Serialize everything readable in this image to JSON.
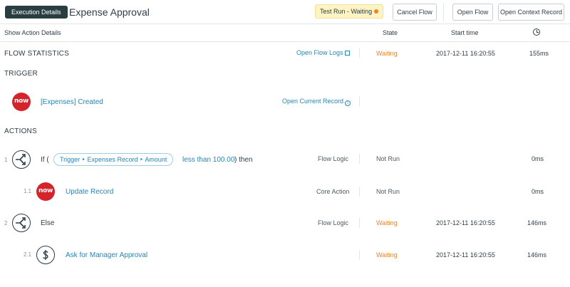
{
  "header": {
    "exec_label": "Execution Details",
    "title": "Expense Approval",
    "status": "Test Run - Waiting",
    "cancel_label": "Cancel Flow",
    "open_flow_label": "Open Flow",
    "open_context_label": "Open Context Record"
  },
  "columns": {
    "details": "Show Action Details",
    "state": "State",
    "start": "Start time"
  },
  "stats": {
    "label": "FLOW STATISTICS",
    "logs_link": "Open Flow Logs",
    "state": "Waiting",
    "start": "2017-12-11 16:20:55",
    "duration": "155ms"
  },
  "trigger": {
    "label": "TRIGGER",
    "name": "[Expenses] Created",
    "record_link": "Open Current Record"
  },
  "actions": {
    "label": "ACTIONS",
    "rows": [
      {
        "num": "1",
        "if_prefix": "If (",
        "pill": "Trigger ‣ Expenses Record ‣ Amount",
        "condition": "less than 100.00",
        "then": ") then",
        "type": "Flow Logic",
        "state": "Not Run",
        "start": "",
        "duration": "0ms"
      },
      {
        "num": "1.1",
        "name": "Update Record",
        "type": "Core Action",
        "state": "Not Run",
        "start": "",
        "duration": "0ms"
      },
      {
        "num": "2",
        "name": "Else",
        "type": "Flow Logic",
        "state": "Waiting",
        "start": "2017-12-11 16:20:55",
        "duration": "146ms"
      },
      {
        "num": "2.1",
        "name": "Ask for Manager Approval",
        "type": "",
        "state": "Waiting",
        "start": "2017-12-11 16:20:55",
        "duration": "146ms"
      }
    ]
  },
  "icons": {
    "status_dot": "status-dot",
    "clock": "clock-icon",
    "external": "external-link-icon",
    "info": "info-icon",
    "servicenow": "servicenow-logo-icon",
    "branch": "flow-logic-branch-icon",
    "approval": "approval-dollar-icon"
  },
  "colors": {
    "dark_pill": "#293e40",
    "status_bg": "#fdf4c4",
    "status_dot": "#f5811f",
    "link": "#2485b6",
    "waiting": "#f5811f",
    "now_red": "#d4232a"
  }
}
